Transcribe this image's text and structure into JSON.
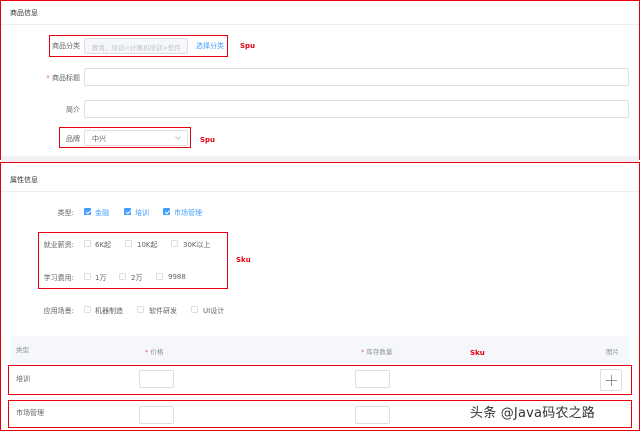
{
  "product_section": {
    "title": "商品信息",
    "category": {
      "label": "商品分类",
      "placeholder": "教育、培训>计算机培训>软件",
      "link": "选择分类",
      "annotation": "Spu"
    },
    "title_field": {
      "required_mark": "*",
      "label": "商品标题",
      "value": ""
    },
    "intro": {
      "label": "简介",
      "value": ""
    },
    "brand": {
      "label": "品牌",
      "value": "中兴",
      "annotation": "Spu"
    }
  },
  "attribute_section": {
    "title": "属性信息",
    "type": {
      "label": "类型:",
      "options": [
        {
          "label": "金融",
          "checked": true
        },
        {
          "label": "培训",
          "checked": true
        },
        {
          "label": "市场管理",
          "checked": true
        }
      ]
    },
    "salary": {
      "label": "就业薪资:",
      "options": [
        {
          "label": "6K起",
          "checked": false
        },
        {
          "label": "10K起",
          "checked": false
        },
        {
          "label": "30K以上",
          "checked": false
        }
      ]
    },
    "fee": {
      "label": "学习费用:",
      "options": [
        {
          "label": "1万",
          "checked": false
        },
        {
          "label": "2万",
          "checked": false
        },
        {
          "label": "9988",
          "checked": false
        }
      ]
    },
    "sku_annotation": "Sku",
    "scene": {
      "label": "应用场景:",
      "options": [
        {
          "label": "机器制造",
          "checked": false
        },
        {
          "label": "软件研发",
          "checked": false
        },
        {
          "label": "UI设计",
          "checked": false
        }
      ]
    }
  },
  "sku_table": {
    "columns": {
      "type": "类型",
      "price": "价格",
      "stock": "库存数量",
      "image": "图片",
      "required_mark": "*"
    },
    "annotation": "Sku",
    "rows": [
      {
        "type": "培训",
        "price": "",
        "stock": ""
      },
      {
        "type": "市场管理",
        "price": "",
        "stock": ""
      }
    ]
  },
  "watermark": "头条 @Java码农之路",
  "colors": {
    "accent": "#409eff",
    "annotation_red": "#e60012",
    "required": "#f56c6c"
  }
}
